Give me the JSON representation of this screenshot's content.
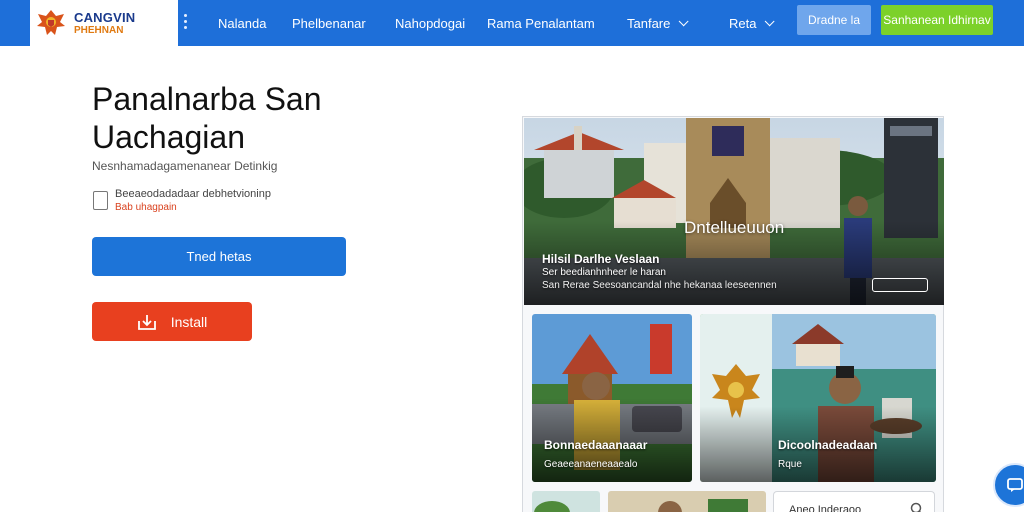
{
  "brand": {
    "line1": "CANGVIN",
    "line2": "PHEHNAN",
    "colors": {
      "primary": "#1e6fd9",
      "green": "#7cd12a",
      "red": "#e8401f",
      "orange": "#e07a12"
    }
  },
  "nav": {
    "menu_icon": "vertical-dots-icon",
    "items": [
      {
        "label": "Nalanda"
      },
      {
        "label": "Phelbenanar"
      },
      {
        "label": "Nahopdogai"
      },
      {
        "label": "Rama Penalantam"
      },
      {
        "label": "Tanfare",
        "dropdown": true
      },
      {
        "label": "Reta",
        "dropdown": true
      }
    ],
    "button_primary": "Dradne la",
    "button_cta": "Sanhanean Idhirnav"
  },
  "hero_text": {
    "title": "Panalnarba San Uachagian",
    "subtitle": "Nesnhamadagamenanear Detinkig",
    "checkbox_label": "Beeaeodadadaar debhetvioninp",
    "checkbox_sub": "Bab uhagpain",
    "checkbox_checked": false,
    "primary_button": "Tned hetas",
    "install_button": "Install",
    "install_icon": "install-icon"
  },
  "gallery": {
    "hero": {
      "center_label": "Dntellueuuon",
      "caption_title": "Hilsil Darlhe Veslaan",
      "caption_line2": "Ser beedianhnheer le haran",
      "caption_line3": "San Rerae Seesoancandal nhe hekanaa leeseennen"
    },
    "cards": [
      {
        "caption": "Bonnaedaaanaaar",
        "sub": "Geaeeanaeneaaealo"
      },
      {
        "caption": "Dicoolnadeadaan",
        "sub": "Rque"
      }
    ],
    "search": {
      "text": "Aneo Inderaoo",
      "icon": "search-icon"
    }
  },
  "fab": {
    "icon": "chat-icon"
  }
}
